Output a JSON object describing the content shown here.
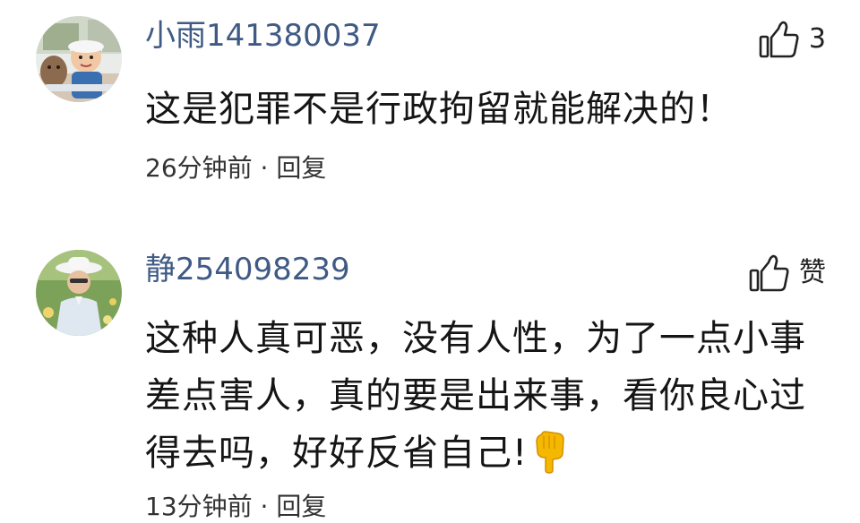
{
  "comments": [
    {
      "username": "小雨141380037",
      "content_lines": [
        "这是犯罪不是行政拘留就能解决的！"
      ],
      "like_label": "3",
      "time": "26分钟前",
      "separator": "·",
      "reply_label": "回复"
    },
    {
      "username": "静254098239",
      "content_lines": [
        "这种人真可恶，没有人性，为了一点小事",
        "差点害人，真的要是出来事，看你良心过",
        "得去吗，好好反省自己!"
      ],
      "like_label": "赞",
      "time": "13分钟前",
      "separator": "·",
      "reply_label": "回复",
      "emoji": "pointing-down-hand-emoji"
    }
  ],
  "icons": {
    "like": "thumbs-up-outline-icon"
  },
  "colors": {
    "username": "#3f5a84",
    "text": "#151515",
    "meta": "#333333",
    "background": "#ffffff",
    "emoji": "#f5b800"
  }
}
